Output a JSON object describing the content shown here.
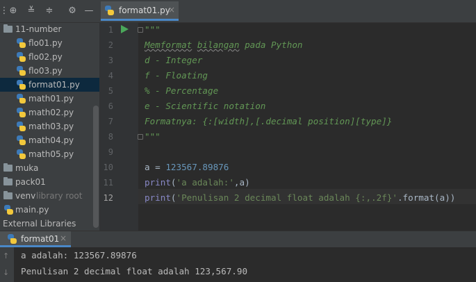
{
  "project": {
    "items": [
      {
        "label": "11-number",
        "type": "folder"
      },
      {
        "label": "flo01.py",
        "type": "py"
      },
      {
        "label": "flo02.py",
        "type": "py"
      },
      {
        "label": "flo03.py",
        "type": "py"
      },
      {
        "label": "format01.py",
        "type": "py",
        "selected": true
      },
      {
        "label": "math01.py",
        "type": "py"
      },
      {
        "label": "math02.py",
        "type": "py"
      },
      {
        "label": "math03.py",
        "type": "py"
      },
      {
        "label": "math04.py",
        "type": "py"
      },
      {
        "label": "math05.py",
        "type": "py"
      },
      {
        "label": "muka",
        "type": "folder"
      },
      {
        "label": "pack01",
        "type": "folder"
      },
      {
        "label": "venv",
        "type": "folder",
        "hint": "library root"
      },
      {
        "label": "main.py",
        "type": "py"
      },
      {
        "label": "External Libraries",
        "type": "ext"
      }
    ],
    "toolbar_icons": [
      "globe-target-icon",
      "expand-all-icon",
      "collapse-all-icon",
      "gear-icon",
      "minimize-icon"
    ]
  },
  "editor": {
    "tab_label": "format01.py",
    "tab_close": "×",
    "line_numbers": [
      "1",
      "2",
      "3",
      "4",
      "5",
      "6",
      "7",
      "8",
      "9",
      "10",
      "11",
      "12"
    ],
    "doc": {
      "open": "\"\"\"",
      "l2": "Memformat bilangan pada Python",
      "l3": "d - Integer",
      "l4": "f - Floating",
      "l5": "% - Percentage",
      "l6": "e - Scientific notation",
      "l7": "Formatnya: {:[width],[.decimal position][type]}",
      "close": "\"\"\""
    },
    "l10": {
      "var": "a = ",
      "num": "123567.89876"
    },
    "l11": {
      "fn": "print",
      "p1": "(",
      "str": "'a adalah:'",
      "rest": ",a)"
    },
    "l12": {
      "fn": "print",
      "p1": "(",
      "str": "'Penulisan 2 decimal float adalah {:,.2f}'",
      "rest": ".format(a))"
    }
  },
  "run": {
    "tab_label": "format01",
    "tab_close": "×",
    "output": [
      "a adalah: 123567.89876",
      "Penulisan 2 decimal float adalah 123,567.90"
    ]
  },
  "colors": {
    "accent": "#4a88c7",
    "docstring": "#629755",
    "string": "#6a8759",
    "number": "#6897bb"
  }
}
